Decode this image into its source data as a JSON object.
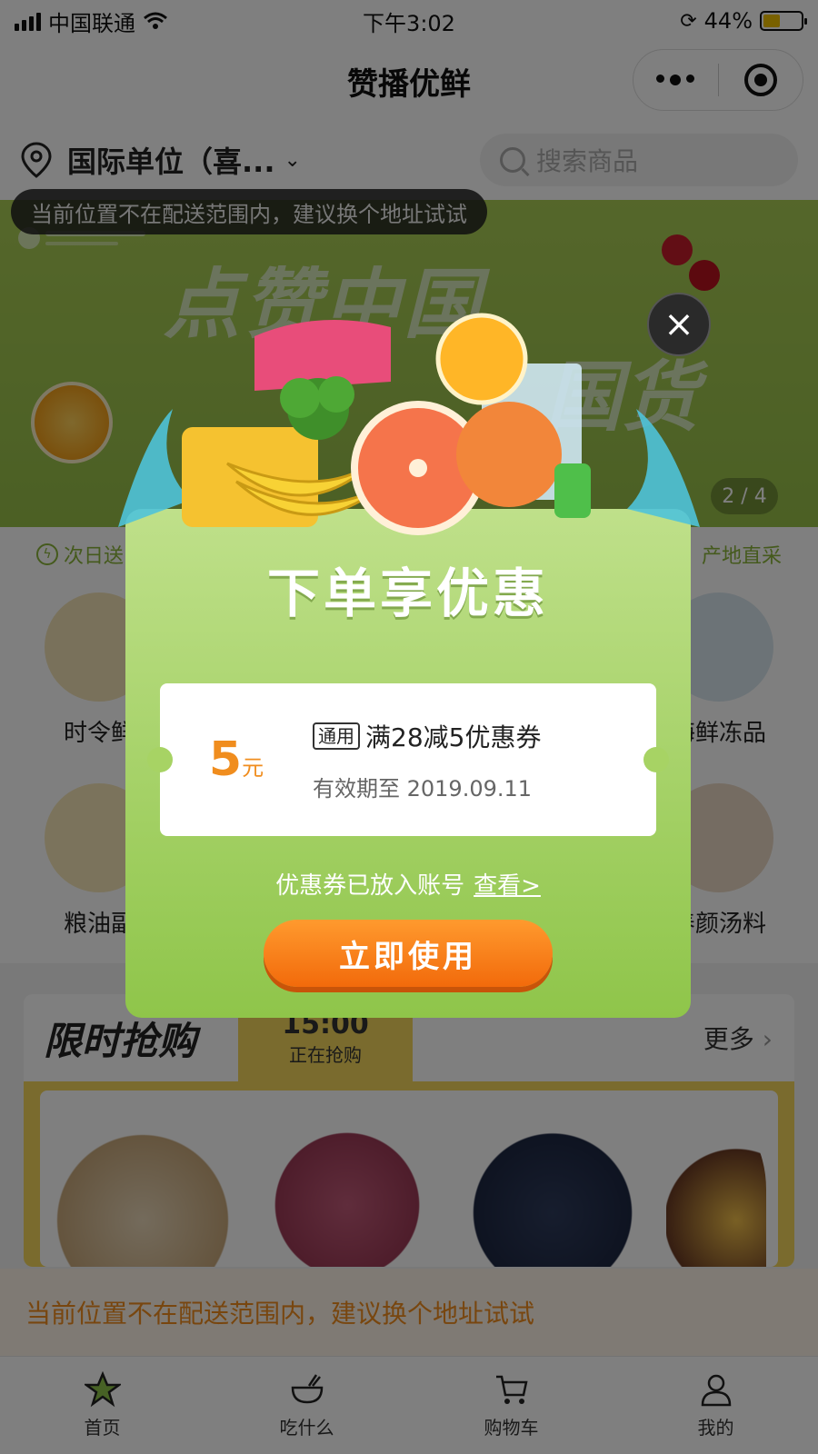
{
  "status_bar": {
    "carrier": "中国联通",
    "time": "下午3:02",
    "battery": "44%",
    "battery_level": 0.44
  },
  "nav": {
    "title": "赞播优鲜"
  },
  "location": {
    "text": "国际单位（喜...",
    "search_placeholder": "搜索商品"
  },
  "toast_top": "当前位置不在配送范围内，建议换个地址试试",
  "banner": {
    "title_1": "点赞中国",
    "title_2": "国货",
    "page_indicator": "2 / 4"
  },
  "features": {
    "left": "次日送",
    "right": "产地直采"
  },
  "categories": [
    {
      "label": "时令鲜",
      "color": "#f3e3b6"
    },
    {
      "label": "海鲜冻品",
      "color": "#d9e6ee"
    },
    {
      "label": "粮油副",
      "color": "#f6e6b8"
    },
    {
      "label": "养颜汤料",
      "color": "#ead8c4"
    }
  ],
  "flash_sale": {
    "title": "限时抢购",
    "time": "15:00",
    "status": "正在抢购",
    "more": "更多"
  },
  "toast_bottom": "当前位置不在配送范围内，建议换个地址试试",
  "tabs": [
    {
      "label": "首页",
      "icon": "home-star-icon"
    },
    {
      "label": "吃什么",
      "icon": "bowl-icon"
    },
    {
      "label": "购物车",
      "icon": "cart-icon"
    },
    {
      "label": "我的",
      "icon": "user-icon"
    }
  ],
  "modal": {
    "title": "下单享优惠",
    "coupon_amount": "5",
    "coupon_unit": "元",
    "coupon_tag": "通用",
    "coupon_name": "满28减5优惠券",
    "coupon_expiry": "有效期至 2019.09.11",
    "note": "优惠券已放入账号",
    "note_link": "查看>",
    "button": "立即使用",
    "close": "×"
  },
  "colors": {
    "brand_green": "#8fc54a",
    "accent_orange": "#f08d1e",
    "flash_yellow": "#f4d75c"
  }
}
